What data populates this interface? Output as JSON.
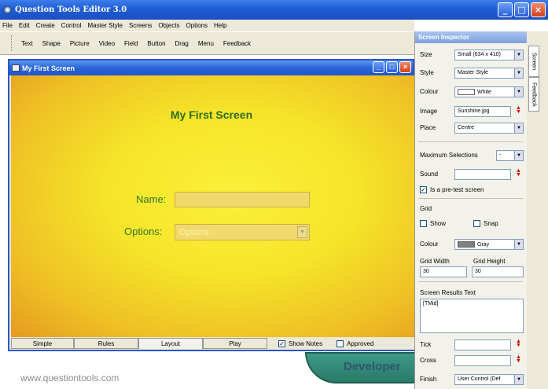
{
  "app": {
    "title": "Question Tools Editor 3.0"
  },
  "menu": [
    "File",
    "Edit",
    "Create",
    "Control",
    "Master Style",
    "Screens",
    "Objects",
    "Options",
    "Help"
  ],
  "toolbar": [
    "Text",
    "Shape",
    "Picture",
    "Video",
    "Field",
    "Button",
    "Drag",
    "Menu",
    "Feedback"
  ],
  "window": {
    "title": "My First Screen",
    "screen_title": "My First Screen",
    "name_label": "Name:",
    "options_label": "Options:",
    "options_placeholder": "Options",
    "tabs": [
      "Simple",
      "Rules",
      "Layout",
      "Play"
    ],
    "active_tab": "Layout",
    "show_notes_label": "Show Notes",
    "show_notes_checked": true,
    "approved_label": "Approved",
    "approved_checked": false
  },
  "background": {
    "developer_text": "Developer",
    "site": "www.questiontools.com"
  },
  "inspector": {
    "title": "Screen Inspector",
    "size_label": "Size",
    "size_value": "Small (634 x 410)",
    "style_label": "Style",
    "style_value": "Master Style",
    "colour_label": "Colour",
    "colour_value": "White",
    "image_label": "Image",
    "image_value": "Sunshine.jpg",
    "place_label": "Place",
    "place_value": "Centre",
    "max_sel_label": "Maximum Selections",
    "max_sel_value": "-",
    "sound_label": "Sound",
    "pretest_label": "Is a pre-test screen",
    "pretest_checked": true,
    "grid_label": "Grid",
    "show_label": "Show",
    "snap_label": "Snap",
    "grid_colour_label": "Colour",
    "grid_colour_value": "Gray",
    "grid_width_label": "Grid Width",
    "grid_width_value": "30",
    "grid_height_label": "Grid Height",
    "grid_height_value": "30",
    "results_label": "Screen Results Text",
    "results_value": "[TMid]",
    "tick_label": "Tick",
    "cross_label": "Cross",
    "finish_label": "Finish",
    "finish_value": "User Control (Def"
  },
  "side_tabs": [
    "Screen",
    "Feedback"
  ],
  "colors": {
    "titlebar": "#1f5ed6",
    "canvas": "#f6e42a",
    "label_green": "#2f7a25"
  }
}
